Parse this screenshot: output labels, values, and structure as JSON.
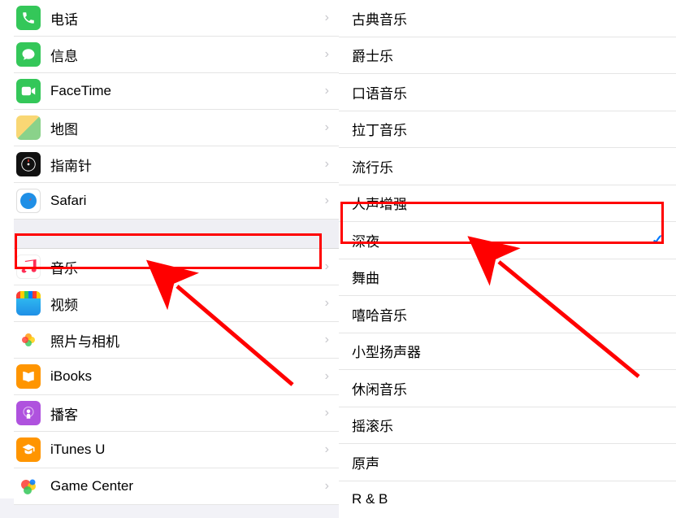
{
  "left": {
    "group1": [
      {
        "label": "电话",
        "icon": "phone"
      },
      {
        "label": "信息",
        "icon": "messages"
      },
      {
        "label": "FaceTime",
        "icon": "facetime"
      },
      {
        "label": "地图",
        "icon": "maps"
      },
      {
        "label": "指南针",
        "icon": "compass"
      },
      {
        "label": "Safari",
        "icon": "safari"
      }
    ],
    "group2": [
      {
        "label": "音乐",
        "icon": "music",
        "highlighted": true
      },
      {
        "label": "视频",
        "icon": "video"
      },
      {
        "label": "照片与相机",
        "icon": "photos"
      },
      {
        "label": "iBooks",
        "icon": "ibooks"
      },
      {
        "label": "播客",
        "icon": "podcast"
      },
      {
        "label": "iTunes U",
        "icon": "itunesu"
      },
      {
        "label": "Game Center",
        "icon": "gamecenter"
      }
    ]
  },
  "right": {
    "items": [
      {
        "label": "古典音乐"
      },
      {
        "label": "爵士乐"
      },
      {
        "label": "口语音乐"
      },
      {
        "label": "拉丁音乐"
      },
      {
        "label": "流行乐"
      },
      {
        "label": "人声增强"
      },
      {
        "label": "深夜",
        "selected": true,
        "highlighted": true
      },
      {
        "label": "舞曲"
      },
      {
        "label": "嘻哈音乐"
      },
      {
        "label": "小型扬声器"
      },
      {
        "label": "休闲音乐"
      },
      {
        "label": "摇滚乐"
      },
      {
        "label": "原声"
      },
      {
        "label": "R & B"
      }
    ]
  },
  "annotations": {
    "highlight_color": "#ff0000",
    "arrow_color": "#ff0000"
  }
}
